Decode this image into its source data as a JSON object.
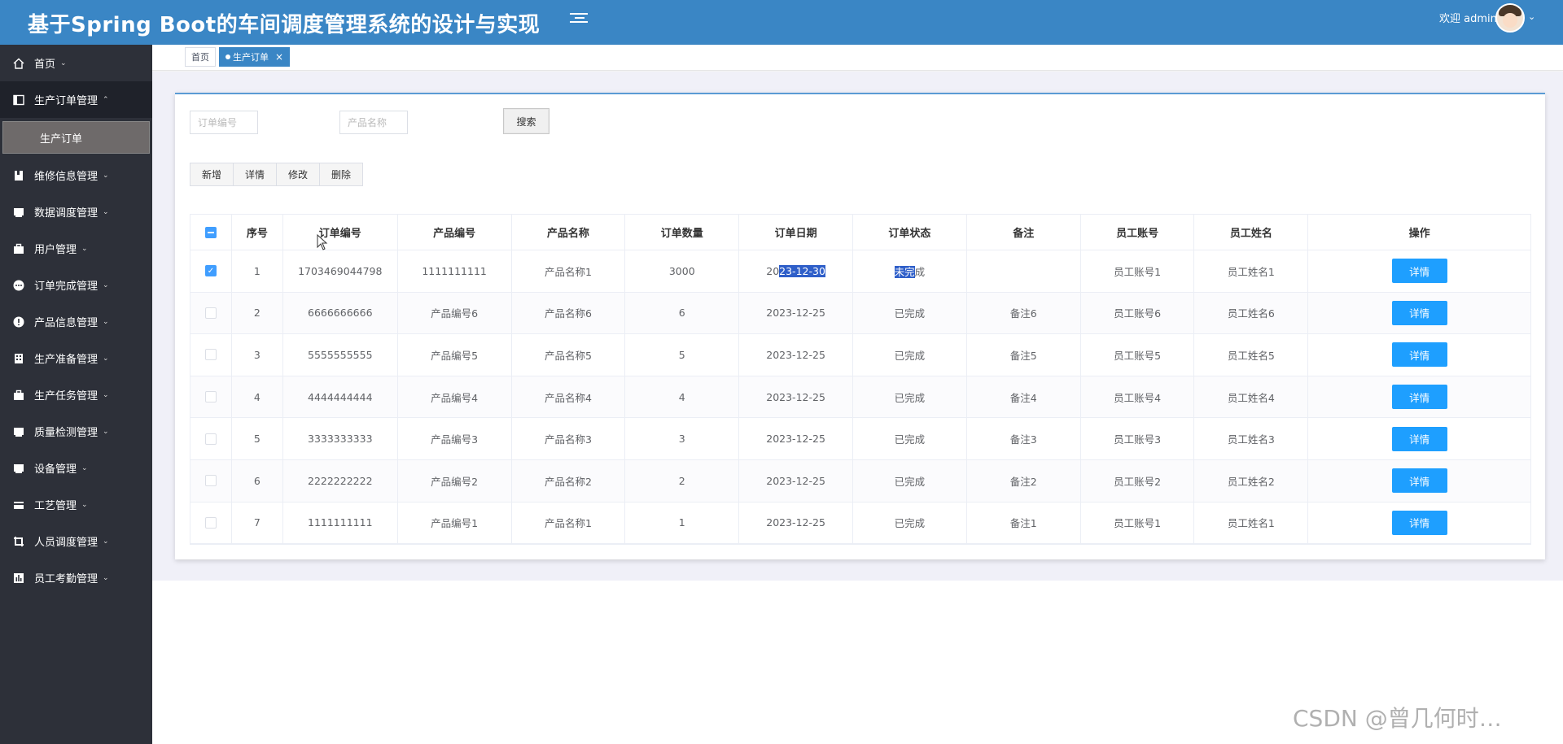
{
  "header": {
    "title": "基于Spring Boot的车间调度管理系统的设计与实现",
    "welcome": "欢迎 admin",
    "caret": "⌄"
  },
  "sidebar": {
    "items": [
      {
        "label": "首页",
        "icon": "home-icon",
        "caret": "⌄"
      },
      {
        "label": "生产订单管理",
        "icon": "panel-icon",
        "caret": "⌃",
        "open": true,
        "children": [
          {
            "label": "生产订单"
          }
        ]
      },
      {
        "label": "维修信息管理",
        "icon": "book-icon",
        "caret": "⌄"
      },
      {
        "label": "数据调度管理",
        "icon": "monitor-icon",
        "caret": "⌄"
      },
      {
        "label": "用户管理",
        "icon": "briefcase-icon",
        "caret": "⌄"
      },
      {
        "label": "订单完成管理",
        "icon": "dots-icon",
        "caret": "⌄"
      },
      {
        "label": "产品信息管理",
        "icon": "info-icon",
        "caret": "⌄"
      },
      {
        "label": "生产准备管理",
        "icon": "building-icon",
        "caret": "⌄"
      },
      {
        "label": "生产任务管理",
        "icon": "briefcase-icon",
        "caret": "⌄"
      },
      {
        "label": "质量检测管理",
        "icon": "monitor-icon",
        "caret": "⌄"
      },
      {
        "label": "设备管理",
        "icon": "monitor-icon",
        "caret": "⌄"
      },
      {
        "label": "工艺管理",
        "icon": "card-icon",
        "caret": "⌄"
      },
      {
        "label": "人员调度管理",
        "icon": "crop-icon",
        "caret": "⌄"
      },
      {
        "label": "员工考勤管理",
        "icon": "chart-icon",
        "caret": "⌄"
      }
    ]
  },
  "tabs": {
    "home": "首页",
    "active": "生产订单",
    "close": "×"
  },
  "search": {
    "order_no_placeholder": "订单编号",
    "product_name_placeholder": "产品名称",
    "button": "搜索"
  },
  "actions": {
    "add": "新增",
    "detail": "详情",
    "edit": "修改",
    "delete": "删除"
  },
  "table": {
    "columns": [
      "序号",
      "订单编号",
      "产品编号",
      "产品名称",
      "订单数量",
      "订单日期",
      "订单状态",
      "备注",
      "员工账号",
      "员工姓名",
      "操作"
    ],
    "detail_label": "详情",
    "rows": [
      {
        "checked": true,
        "index": "1",
        "order_no": "1703469044798",
        "product_no": "1111111111",
        "product_name": "产品名称1",
        "qty": "3000",
        "date": "2023-12-30",
        "status": "未完成",
        "remark": "",
        "emp_account": "员工账号1",
        "emp_name": "员工姓名1"
      },
      {
        "checked": false,
        "index": "2",
        "order_no": "6666666666",
        "product_no": "产品编号6",
        "product_name": "产品名称6",
        "qty": "6",
        "date": "2023-12-25",
        "status": "已完成",
        "remark": "备注6",
        "emp_account": "员工账号6",
        "emp_name": "员工姓名6"
      },
      {
        "checked": false,
        "index": "3",
        "order_no": "5555555555",
        "product_no": "产品编号5",
        "product_name": "产品名称5",
        "qty": "5",
        "date": "2023-12-25",
        "status": "已完成",
        "remark": "备注5",
        "emp_account": "员工账号5",
        "emp_name": "员工姓名5"
      },
      {
        "checked": false,
        "index": "4",
        "order_no": "4444444444",
        "product_no": "产品编号4",
        "product_name": "产品名称4",
        "qty": "4",
        "date": "2023-12-25",
        "status": "已完成",
        "remark": "备注4",
        "emp_account": "员工账号4",
        "emp_name": "员工姓名4"
      },
      {
        "checked": false,
        "index": "5",
        "order_no": "3333333333",
        "product_no": "产品编号3",
        "product_name": "产品名称3",
        "qty": "3",
        "date": "2023-12-25",
        "status": "已完成",
        "remark": "备注3",
        "emp_account": "员工账号3",
        "emp_name": "员工姓名3"
      },
      {
        "checked": false,
        "index": "6",
        "order_no": "2222222222",
        "product_no": "产品编号2",
        "product_name": "产品名称2",
        "qty": "2",
        "date": "2023-12-25",
        "status": "已完成",
        "remark": "备注2",
        "emp_account": "员工账号2",
        "emp_name": "员工姓名2"
      },
      {
        "checked": false,
        "index": "7",
        "order_no": "1111111111",
        "product_no": "产品编号1",
        "product_name": "产品名称1",
        "qty": "1",
        "date": "2023-12-25",
        "status": "已完成",
        "remark": "备注1",
        "emp_account": "员工账号1",
        "emp_name": "员工姓名1"
      }
    ]
  },
  "watermark": "CSDN @曾几何时…",
  "colors": {
    "header_bg": "#3a86c5",
    "sidebar_bg": "#2d3039",
    "detail_button": "#1e9fff",
    "checkbox_accent": "#409eff"
  }
}
